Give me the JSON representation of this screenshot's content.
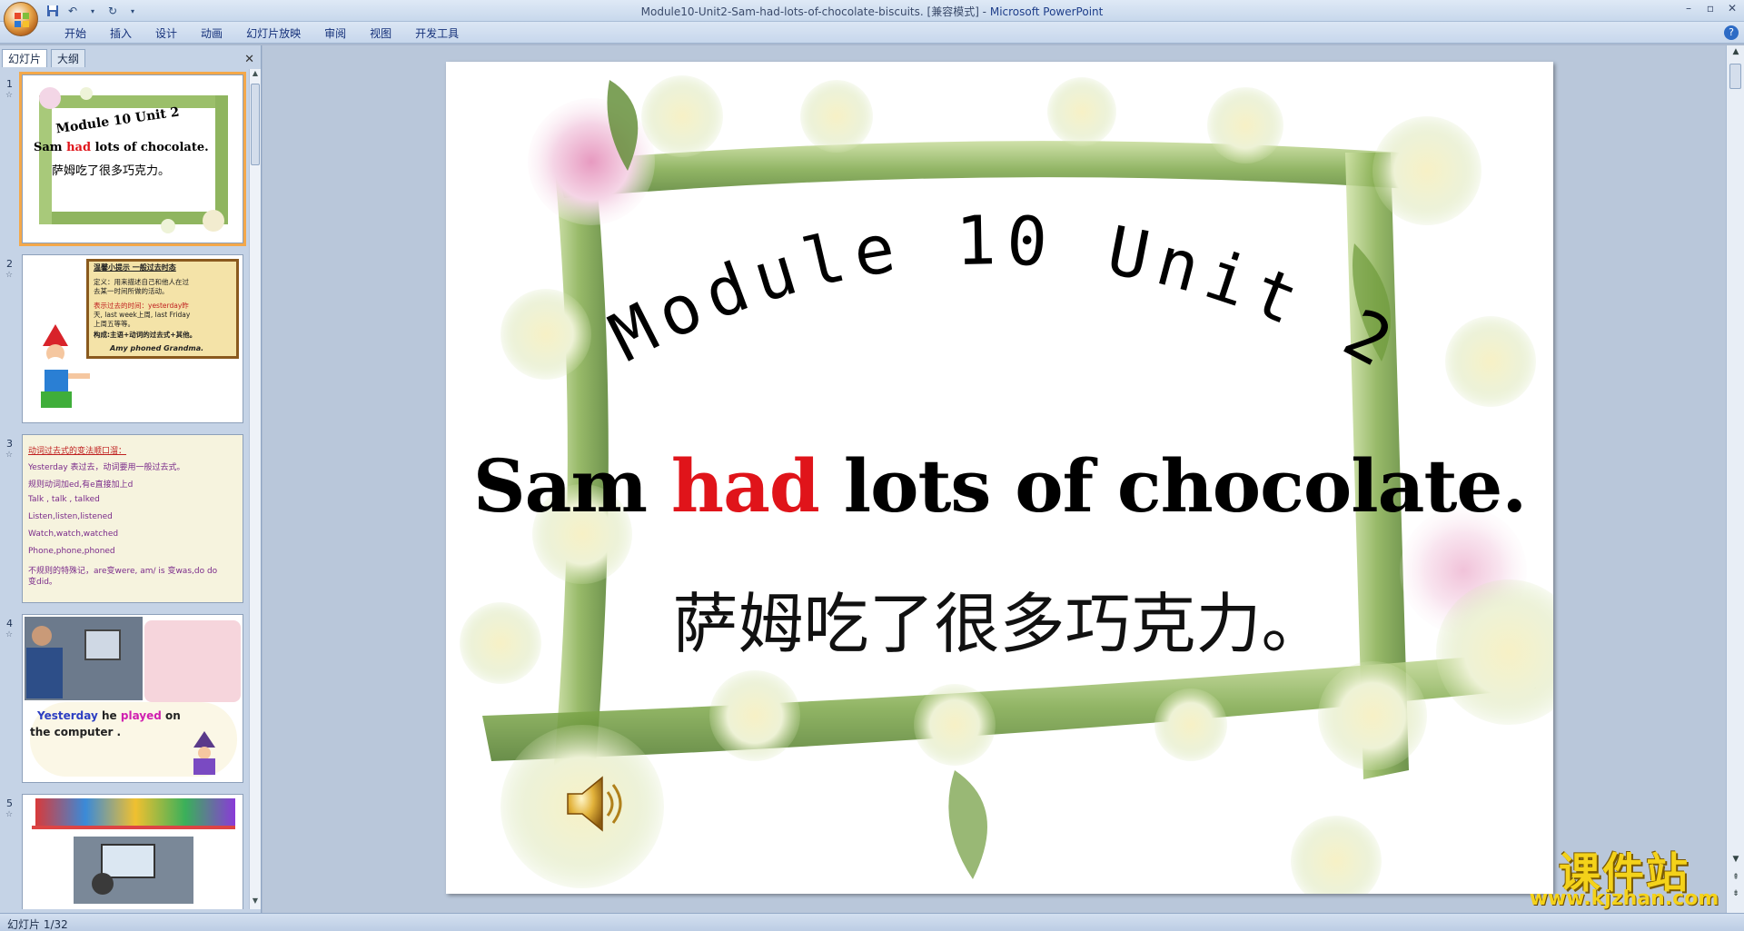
{
  "window": {
    "title": "Module10-Unit2-Sam-had-lots-of-chocolate-biscuits. [兼容模式] - ",
    "app_name": "Microsoft PowerPoint"
  },
  "ribbon": {
    "tabs": [
      "开始",
      "插入",
      "设计",
      "动画",
      "幻灯片放映",
      "审阅",
      "视图",
      "开发工具"
    ]
  },
  "left_panel": {
    "tabs": [
      "幻灯片",
      "大纲"
    ],
    "slides": [
      {
        "num": "1",
        "heading": "Module 10 Unit 2",
        "title_a": "Sam ",
        "title_b": "had",
        "title_c": " lots of chocolate.",
        "cn": "萨姆吃了很多巧克力。"
      },
      {
        "num": "2",
        "lines": [
          "温馨小提示  一般过去时态",
          "定义：用来描述自己和他人在过",
          "去某一时间所做的活动。",
          "表示过去的时间：yesterday昨",
          "天, last week上周, last  Friday",
          "上周五等等。",
          "构成:主语+动词的过去式+其他。",
          "Amy phoned Grandma."
        ]
      },
      {
        "num": "3",
        "lines": [
          "动词过去式的变法顺口溜：",
          "Yesterday 表过去，动词要用一般过去式。",
          "规则动词加ed,有e直接加上d",
          "Talk , talk , talked",
          "Listen,listen,listened",
          "Watch,watch,watched",
          "Phone,phone,phoned",
          "不规则的特殊记，are变were, am/ is 变was,do do",
          "变did。"
        ]
      },
      {
        "num": "4",
        "caption_a": "Yesterday",
        "caption_b": " he ",
        "caption_c": "played",
        "caption_d": " on",
        "caption_e": "the computer ."
      },
      {
        "num": "5"
      }
    ]
  },
  "slide": {
    "arc_text": "Module 10 Unit 2",
    "title_a": "Sam ",
    "title_b": "had",
    "title_c": " lots of chocolate.",
    "cn": "萨姆吃了很多巧克力。"
  },
  "watermark": {
    "cn": "课件站",
    "url": "www.kjzhan.com"
  },
  "status": {
    "slide_info": "幻灯片 1/32"
  }
}
